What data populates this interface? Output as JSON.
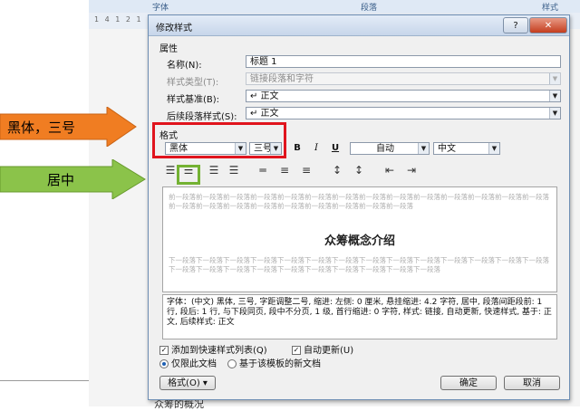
{
  "background": {
    "ribbon_groups": [
      "字体",
      "段落",
      "样式"
    ],
    "ruler_text": "1 4 1 2 1",
    "doc_bottom_text": "众筹的概况"
  },
  "annotations": {
    "font_callout": "黑体，三号",
    "align_callout": "居中",
    "arrow_color": "#f07d22",
    "align_arrow_color": "#8bc34a",
    "red_box_color": "#e0141d",
    "green_box_color": "#74b233"
  },
  "dialog": {
    "title": "修改样式",
    "help_label": "?",
    "close_label": "✕",
    "properties_header": "属性",
    "name_label": "名称(N):",
    "name_value": "标题 1",
    "style_type_label": "样式类型(T):",
    "style_type_value": "链接段落和字符",
    "based_on_label": "样式基准(B):",
    "based_on_value": "↵ 正文",
    "next_style_label": "后续段落样式(S):",
    "next_style_value": "↵ 正文",
    "format_header": "格式",
    "font_value": "黑体",
    "size_value": "三号",
    "bold": "B",
    "italic": "I",
    "underline": "U",
    "color_value": "自动",
    "lang_value": "中文",
    "align_icons": [
      "align-left-icon",
      "align-center-icon",
      "align-right-icon",
      "justify-icon",
      "line-spacing-single-icon",
      "line-spacing-onehalf-icon",
      "line-spacing-double-icon",
      "space-before-icon",
      "space-after-icon",
      "indent-decrease-icon",
      "indent-increase-icon"
    ],
    "preview_prev": "前一段落前一段落前一段落前一段落前一段落前一段落前一段落前一段落前一段落前一段落前一段落前一段落前一段落前一段落前一段落前一段落前一段落前一段落前一段落前一段落前一段落前一段落前一段落",
    "preview_title": "众筹概念介绍",
    "preview_next": "下一段落下一段落下一段落下一段落下一段落下一段落下一段落下一段落下一段落下一段落下一段落下一段落下一段落下一段落下一段落下一段落下一段落下一段落下一段落下一段落下一段落下一段落下一段落下一段落",
    "description": "字体：(中文) 黑体, 三号, 字距调整二号, 缩进: 左侧: 0 厘米, 悬挂缩进: 4.2 字符, 居中, 段落间距段前: 1 行, 段后: 1 行, 与下段同页, 段中不分页, 1 级, 首行缩进: 0 字符, 样式: 链接, 自动更新, 快速样式, 基于: 正文, 后续样式: 正文",
    "add_quick_style": "添加到快速样式列表(Q)",
    "auto_update": "自动更新(U)",
    "only_this_doc": "仅限此文档",
    "new_docs_template": "基于该模板的新文档",
    "format_button": "格式(O) ▾",
    "ok_button": "确定",
    "cancel_button": "取消"
  }
}
